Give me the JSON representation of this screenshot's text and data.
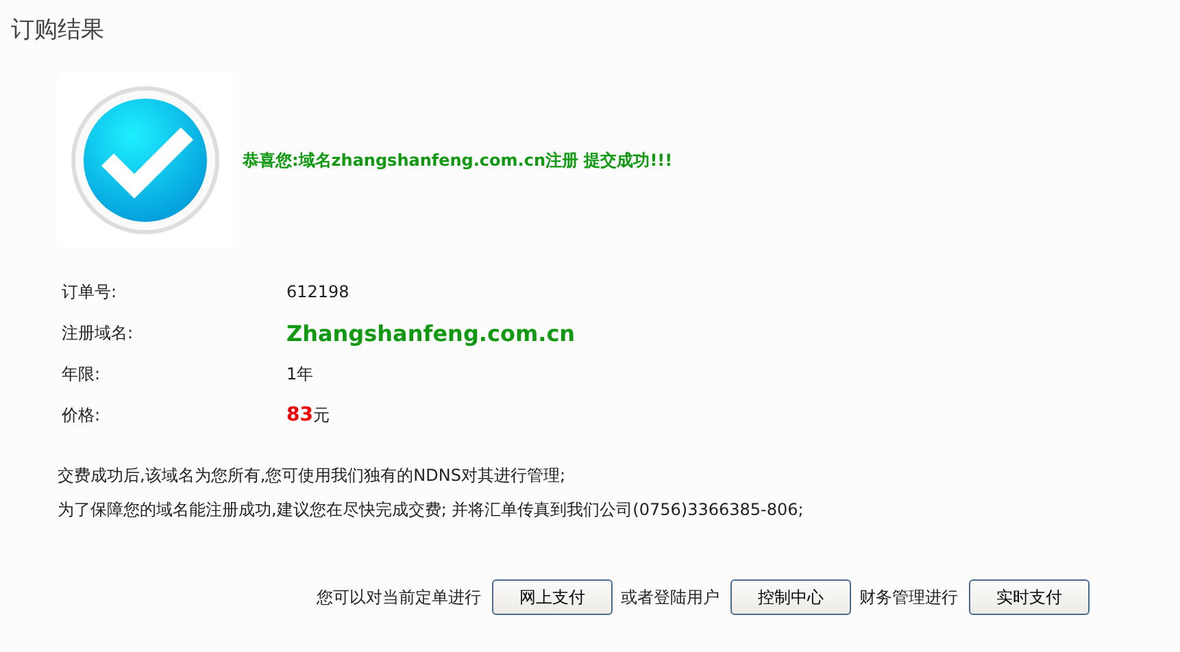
{
  "page": {
    "title": "订购结果"
  },
  "result": {
    "message": "恭喜您:域名zhangshanfeng.com.cn注册 提交成功!!!"
  },
  "details": [
    {
      "kind": "text",
      "label": "订单号:",
      "value": "612198"
    },
    {
      "kind": "domain",
      "label": "注册域名:",
      "value": "Zhangshanfeng.com.cn"
    },
    {
      "kind": "text",
      "label": "年限:",
      "value": "1年"
    },
    {
      "kind": "price",
      "label": "价格:",
      "value": "83",
      "unit": "元"
    }
  ],
  "notes": [
    "交费成功后,该域名为您所有,您可使用我们独有的NDNS对其进行管理;",
    "为了保障您的域名能注册成功,建议您在尽快完成交费; 并将汇单传真到我们公司(0756)3366385-806;"
  ],
  "actions": [
    {
      "text": "您可以对当前定单进行",
      "button": "网上支付"
    },
    {
      "text": "或者登陆用户",
      "button": "控制中心"
    },
    {
      "text": "财务管理进行",
      "button": "实时支付"
    }
  ]
}
